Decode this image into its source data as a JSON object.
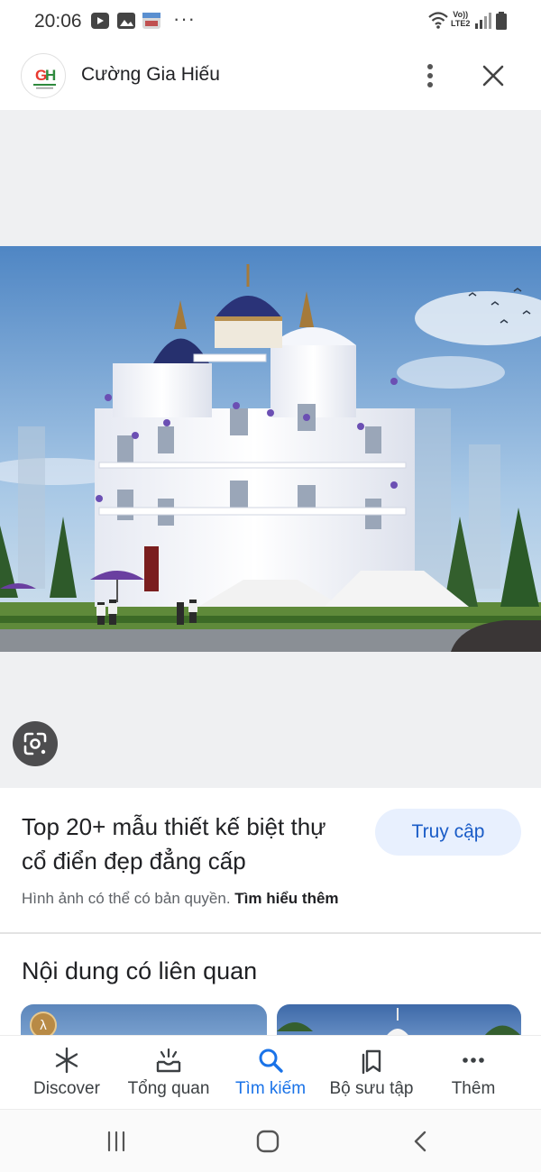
{
  "status_bar": {
    "time": "20:06",
    "dots": "···",
    "network_label_1": "Vo))",
    "network_label_2": "LTE2"
  },
  "header": {
    "site_name": "Cường Gia Hiếu",
    "logo_text": "GH"
  },
  "result": {
    "title": "Top 20+ mẫu thiết kế biệt thự cổ điển đẹp đẳng cấp",
    "visit_label": "Truy cập",
    "copyright_text": "Hình ảnh có thể có bản quyền.",
    "learn_more": "Tìm hiểu thêm"
  },
  "related": {
    "heading": "Nội dung có liên quan"
  },
  "bottom_nav": {
    "items": [
      {
        "label": "Discover",
        "icon": "asterisk-icon"
      },
      {
        "label": "Tổng quan",
        "icon": "tray-icon"
      },
      {
        "label": "Tìm kiếm",
        "icon": "search-icon",
        "active": true
      },
      {
        "label": "Bộ sưu tập",
        "icon": "collections-icon"
      },
      {
        "label": "Thêm",
        "icon": "more-horizontal-icon"
      }
    ]
  },
  "colors": {
    "accent": "#1a73e8",
    "visit_button_bg": "#e8f0fe",
    "viewer_bg": "#eff0f2"
  }
}
